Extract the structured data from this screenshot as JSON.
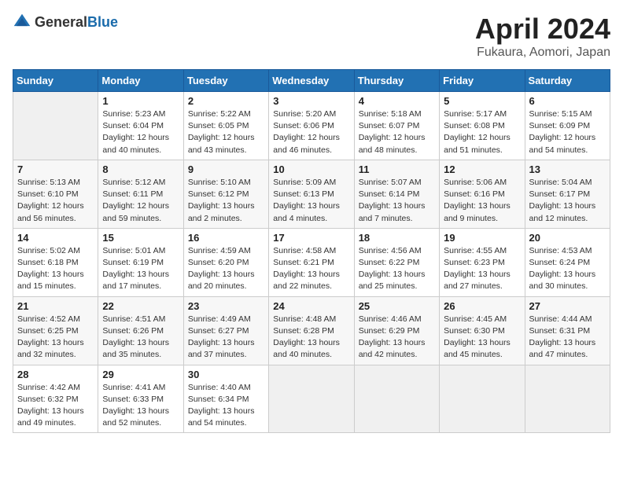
{
  "header": {
    "logo_general": "General",
    "logo_blue": "Blue",
    "month_title": "April 2024",
    "location": "Fukaura, Aomori, Japan"
  },
  "days_of_week": [
    "Sunday",
    "Monday",
    "Tuesday",
    "Wednesday",
    "Thursday",
    "Friday",
    "Saturday"
  ],
  "weeks": [
    [
      {
        "day": "",
        "info": ""
      },
      {
        "day": "1",
        "info": "Sunrise: 5:23 AM\nSunset: 6:04 PM\nDaylight: 12 hours\nand 40 minutes."
      },
      {
        "day": "2",
        "info": "Sunrise: 5:22 AM\nSunset: 6:05 PM\nDaylight: 12 hours\nand 43 minutes."
      },
      {
        "day": "3",
        "info": "Sunrise: 5:20 AM\nSunset: 6:06 PM\nDaylight: 12 hours\nand 46 minutes."
      },
      {
        "day": "4",
        "info": "Sunrise: 5:18 AM\nSunset: 6:07 PM\nDaylight: 12 hours\nand 48 minutes."
      },
      {
        "day": "5",
        "info": "Sunrise: 5:17 AM\nSunset: 6:08 PM\nDaylight: 12 hours\nand 51 minutes."
      },
      {
        "day": "6",
        "info": "Sunrise: 5:15 AM\nSunset: 6:09 PM\nDaylight: 12 hours\nand 54 minutes."
      }
    ],
    [
      {
        "day": "7",
        "info": "Sunrise: 5:13 AM\nSunset: 6:10 PM\nDaylight: 12 hours\nand 56 minutes."
      },
      {
        "day": "8",
        "info": "Sunrise: 5:12 AM\nSunset: 6:11 PM\nDaylight: 12 hours\nand 59 minutes."
      },
      {
        "day": "9",
        "info": "Sunrise: 5:10 AM\nSunset: 6:12 PM\nDaylight: 13 hours\nand 2 minutes."
      },
      {
        "day": "10",
        "info": "Sunrise: 5:09 AM\nSunset: 6:13 PM\nDaylight: 13 hours\nand 4 minutes."
      },
      {
        "day": "11",
        "info": "Sunrise: 5:07 AM\nSunset: 6:14 PM\nDaylight: 13 hours\nand 7 minutes."
      },
      {
        "day": "12",
        "info": "Sunrise: 5:06 AM\nSunset: 6:16 PM\nDaylight: 13 hours\nand 9 minutes."
      },
      {
        "day": "13",
        "info": "Sunrise: 5:04 AM\nSunset: 6:17 PM\nDaylight: 13 hours\nand 12 minutes."
      }
    ],
    [
      {
        "day": "14",
        "info": "Sunrise: 5:02 AM\nSunset: 6:18 PM\nDaylight: 13 hours\nand 15 minutes."
      },
      {
        "day": "15",
        "info": "Sunrise: 5:01 AM\nSunset: 6:19 PM\nDaylight: 13 hours\nand 17 minutes."
      },
      {
        "day": "16",
        "info": "Sunrise: 4:59 AM\nSunset: 6:20 PM\nDaylight: 13 hours\nand 20 minutes."
      },
      {
        "day": "17",
        "info": "Sunrise: 4:58 AM\nSunset: 6:21 PM\nDaylight: 13 hours\nand 22 minutes."
      },
      {
        "day": "18",
        "info": "Sunrise: 4:56 AM\nSunset: 6:22 PM\nDaylight: 13 hours\nand 25 minutes."
      },
      {
        "day": "19",
        "info": "Sunrise: 4:55 AM\nSunset: 6:23 PM\nDaylight: 13 hours\nand 27 minutes."
      },
      {
        "day": "20",
        "info": "Sunrise: 4:53 AM\nSunset: 6:24 PM\nDaylight: 13 hours\nand 30 minutes."
      }
    ],
    [
      {
        "day": "21",
        "info": "Sunrise: 4:52 AM\nSunset: 6:25 PM\nDaylight: 13 hours\nand 32 minutes."
      },
      {
        "day": "22",
        "info": "Sunrise: 4:51 AM\nSunset: 6:26 PM\nDaylight: 13 hours\nand 35 minutes."
      },
      {
        "day": "23",
        "info": "Sunrise: 4:49 AM\nSunset: 6:27 PM\nDaylight: 13 hours\nand 37 minutes."
      },
      {
        "day": "24",
        "info": "Sunrise: 4:48 AM\nSunset: 6:28 PM\nDaylight: 13 hours\nand 40 minutes."
      },
      {
        "day": "25",
        "info": "Sunrise: 4:46 AM\nSunset: 6:29 PM\nDaylight: 13 hours\nand 42 minutes."
      },
      {
        "day": "26",
        "info": "Sunrise: 4:45 AM\nSunset: 6:30 PM\nDaylight: 13 hours\nand 45 minutes."
      },
      {
        "day": "27",
        "info": "Sunrise: 4:44 AM\nSunset: 6:31 PM\nDaylight: 13 hours\nand 47 minutes."
      }
    ],
    [
      {
        "day": "28",
        "info": "Sunrise: 4:42 AM\nSunset: 6:32 PM\nDaylight: 13 hours\nand 49 minutes."
      },
      {
        "day": "29",
        "info": "Sunrise: 4:41 AM\nSunset: 6:33 PM\nDaylight: 13 hours\nand 52 minutes."
      },
      {
        "day": "30",
        "info": "Sunrise: 4:40 AM\nSunset: 6:34 PM\nDaylight: 13 hours\nand 54 minutes."
      },
      {
        "day": "",
        "info": ""
      },
      {
        "day": "",
        "info": ""
      },
      {
        "day": "",
        "info": ""
      },
      {
        "day": "",
        "info": ""
      }
    ]
  ]
}
